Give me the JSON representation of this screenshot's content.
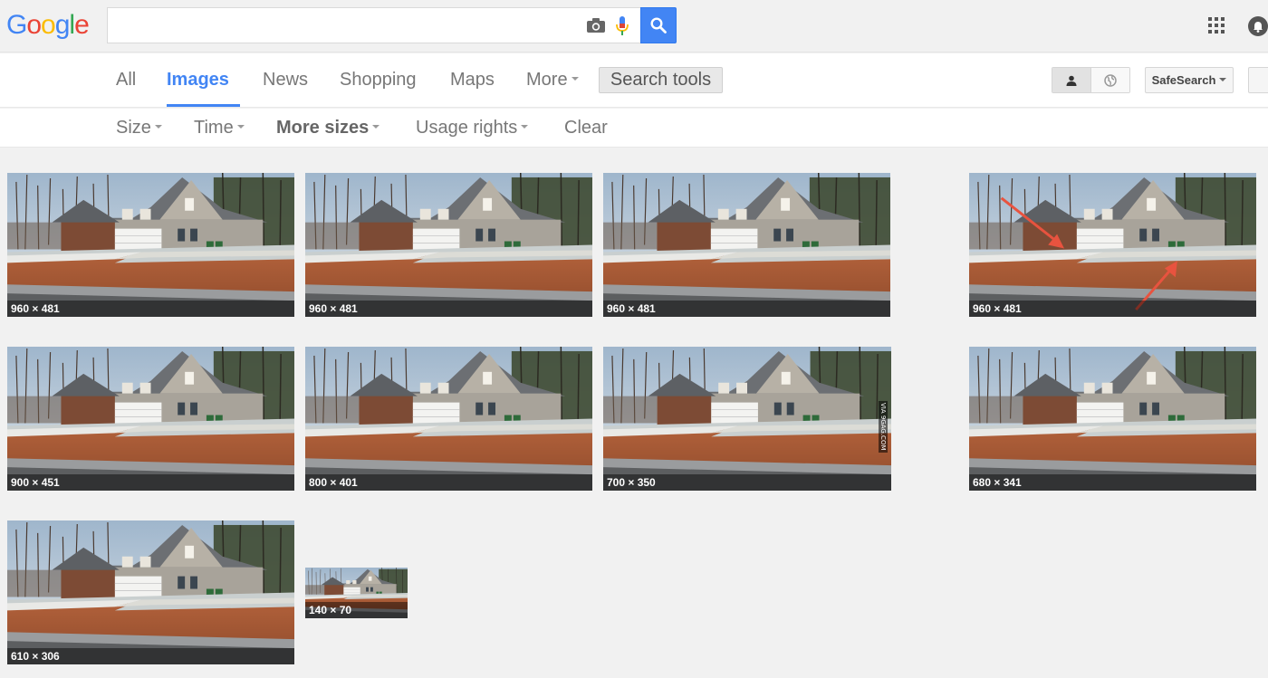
{
  "logo": {
    "letters": [
      "G",
      "o",
      "o",
      "g",
      "l",
      "e"
    ]
  },
  "search": {
    "query": "",
    "placeholder": ""
  },
  "icons": {
    "camera": "camera-icon",
    "mic": "mic-icon",
    "search": "search-icon",
    "apps": "apps-grid-icon",
    "notifications": "notifications-icon",
    "person": "person-icon",
    "globe": "globe-icon"
  },
  "nav": {
    "tabs": [
      {
        "label": "All"
      },
      {
        "label": "Images",
        "active": true
      },
      {
        "label": "News"
      },
      {
        "label": "Shopping"
      },
      {
        "label": "Maps"
      },
      {
        "label": "More"
      }
    ],
    "search_tools": "Search tools",
    "safesearch": "SafeSearch"
  },
  "tools": {
    "size": "Size",
    "time": "Time",
    "more_sizes": "More sizes",
    "usage_rights": "Usage rights",
    "clear": "Clear"
  },
  "images": [
    {
      "dims": "960 × 481"
    },
    {
      "dims": "960 × 481"
    },
    {
      "dims": "960 × 481"
    },
    {
      "dims": "960 × 481",
      "arrows": true
    },
    {
      "dims": "900 × 451"
    },
    {
      "dims": "800 × 401"
    },
    {
      "dims": "700 × 350",
      "watermark": "VIA 9GAG.COM"
    },
    {
      "dims": "680 × 341"
    },
    {
      "dims": "610 × 306"
    },
    {
      "dims": "140 × 70"
    }
  ],
  "colors": {
    "accent": "#4285f4",
    "arrow": "#e8533f"
  }
}
